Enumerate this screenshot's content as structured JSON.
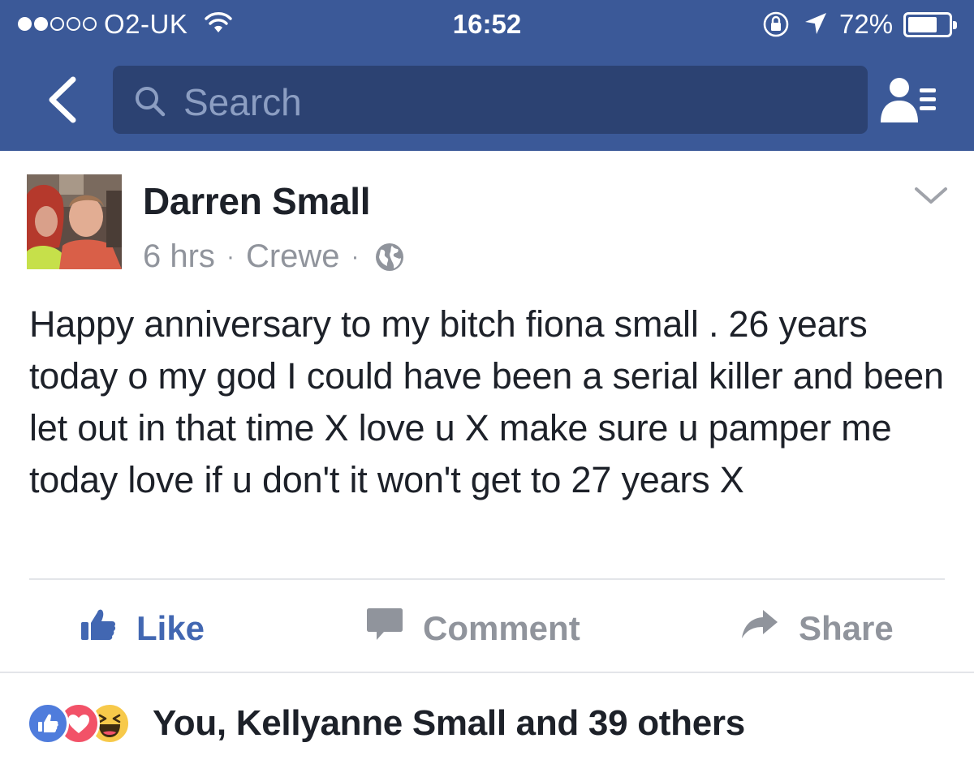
{
  "status_bar": {
    "carrier": "O2-UK",
    "time": "16:52",
    "battery_percent": "72%",
    "battery_level": 0.72,
    "signal_bars_filled": 2,
    "signal_bars_total": 5
  },
  "nav": {
    "search_placeholder": "Search",
    "back_icon": "chevron-left-icon",
    "friends_icon": "friend-requests-icon"
  },
  "post": {
    "author": "Darren Small",
    "time_ago": "6 hrs",
    "location": "Crewe",
    "separator": "·",
    "privacy_icon": "globe-icon",
    "text": "Happy anniversary to my bitch fiona small . 26 years today o my god I could have been a serial killer and been let out in that time X love u X make sure u pamper me today love if u don't it won't get to 27 years X"
  },
  "actions": {
    "like": "Like",
    "comment": "Comment",
    "share": "Share"
  },
  "reactions": {
    "summary": "You, Kellyanne Small and 39 others",
    "types": [
      "like",
      "love",
      "haha"
    ]
  },
  "colors": {
    "facebook_blue": "#3b5998",
    "search_bg": "#2c4272",
    "like_blue": "#4267b2",
    "meta_gray": "#90949c",
    "text_dark": "#1d2129"
  }
}
